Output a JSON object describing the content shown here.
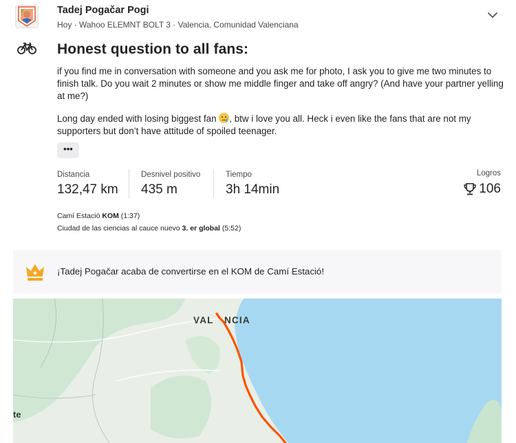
{
  "activity": {
    "athlete_name": "Tadej Pogačar Pogi",
    "meta": "Hoy · Wahoo ELEMNT BOLT 3 · Valencia, Comunidad Valenciana",
    "sport_icon": "bike-icon",
    "title": "Honest question to all fans:",
    "description": [
      "if you find me in conversation with someone and you ask me for photo, I ask you to give me two minutes to finish talk. Do you wait 2 minutes or show me middle finger and take off angry? (And have your partner yelling at me?)",
      {
        "before": "Long day ended with losing biggest fan",
        "emoji": "crying-face-emoji",
        "after": ", btw i love you all. Heck i even like the fans that are not my supporters but don’t have attitude of spoiled teenager."
      }
    ],
    "more_label": "•••"
  },
  "stats": [
    {
      "label": "Distancia",
      "value": "132,47 km"
    },
    {
      "label": "Desnivel positivo",
      "value": "435 m"
    },
    {
      "label": "Tiempo",
      "value": "3h 14min"
    }
  ],
  "achievements": {
    "label": "Logros",
    "value": "106",
    "icon": "trophy-icon"
  },
  "segments": [
    {
      "name": "Camí Estació",
      "badge": "KOM",
      "time": "(1:37)"
    },
    {
      "name": "Ciudad de las ciencias al cauce nuevo",
      "badge": "3. er global",
      "time": "(5:52)"
    }
  ],
  "kom_banner": {
    "icon": "crown-icon",
    "text": "¡Tadej Pogačar acaba de convertirse en el KOM de Camí Estació!"
  },
  "map": {
    "city_label_left": "VAL",
    "city_label_right": "NCIA",
    "edge_label": "te"
  },
  "colors": {
    "route": "#fc5200",
    "sea": "#a7d8f2",
    "land": "#e9efe6",
    "crown": "#f5a623"
  }
}
